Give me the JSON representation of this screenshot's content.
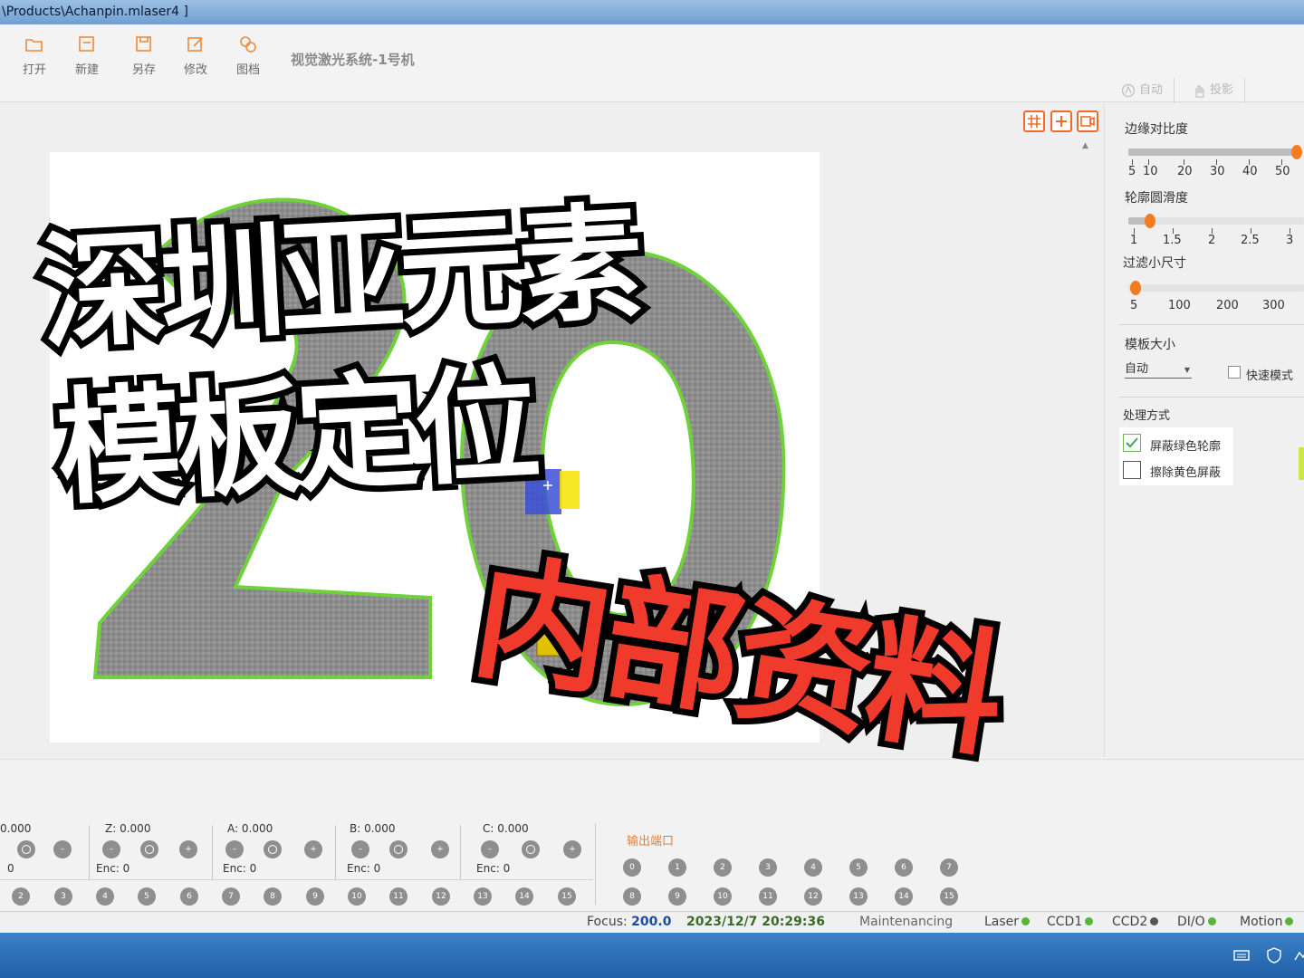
{
  "window": {
    "title": "\\Products\\Achanpin.mlaser4 ]"
  },
  "toolbar": {
    "open": "打开",
    "new": "新建",
    "save_as": "另存",
    "edit": "修改",
    "library": "图档",
    "app_title": "视觉激光系统-1号机"
  },
  "right_tabs": {
    "auto": "自动",
    "projection": "投影"
  },
  "overlay": {
    "line1": "深圳亚元素",
    "line2": "模板定位",
    "line3": "内部资料"
  },
  "params": {
    "edge_contrast": {
      "label": "边缘对比度",
      "ticks": [
        "5",
        "10",
        "20",
        "30",
        "40",
        "50"
      ]
    },
    "contour_smooth": {
      "label": "轮廓圆滑度",
      "ticks": [
        "1",
        "1.5",
        "2",
        "2.5",
        "3"
      ]
    },
    "filter_size": {
      "label": "过滤小尺寸",
      "ticks": [
        "5",
        "100",
        "200",
        "300"
      ]
    },
    "template_size": {
      "label": "模板大小",
      "value": "自动"
    },
    "fast_mode": "快速模式",
    "processing": {
      "label": "处理方式",
      "mask_green": "屏蔽绿色轮廓",
      "erase_yellow": "擦除黄色屏蔽"
    }
  },
  "axes": [
    {
      "label": "0.000",
      "enc": "0"
    },
    {
      "label": "Z:",
      "value": "0.000",
      "enc_label": "Enc:",
      "enc": "0"
    },
    {
      "label": "A:",
      "value": "0.000",
      "enc_label": "Enc:",
      "enc": "0"
    },
    {
      "label": "B:",
      "value": "0.000",
      "enc_label": "Enc:",
      "enc": "0"
    },
    {
      "label": "C:",
      "value": "0.000",
      "enc_label": "Enc:",
      "enc": "0"
    }
  ],
  "input_ports": [
    "2",
    "3",
    "4",
    "5",
    "6",
    "7",
    "8",
    "9",
    "10",
    "11",
    "12",
    "13",
    "14",
    "15"
  ],
  "output": {
    "label": "输出端口",
    "row1": [
      "0",
      "1",
      "2",
      "3",
      "4",
      "5",
      "6",
      "7"
    ],
    "row2": [
      "8",
      "9",
      "10",
      "11",
      "12",
      "13",
      "14",
      "15"
    ]
  },
  "status": {
    "focus_label": "Focus:",
    "focus_value": "200.0",
    "datetime": "2023/12/7 20:29:36",
    "mode": "Maintenancing",
    "laser": "Laser",
    "ccd1": "CCD1",
    "ccd2": "CCD2",
    "dio": "DI/O",
    "motion": "Motion"
  },
  "colors": {
    "accent": "#f47b20",
    "contour": "#6fd23a",
    "status_ok": "#56b436",
    "overlay_red": "#ef3a2c"
  }
}
